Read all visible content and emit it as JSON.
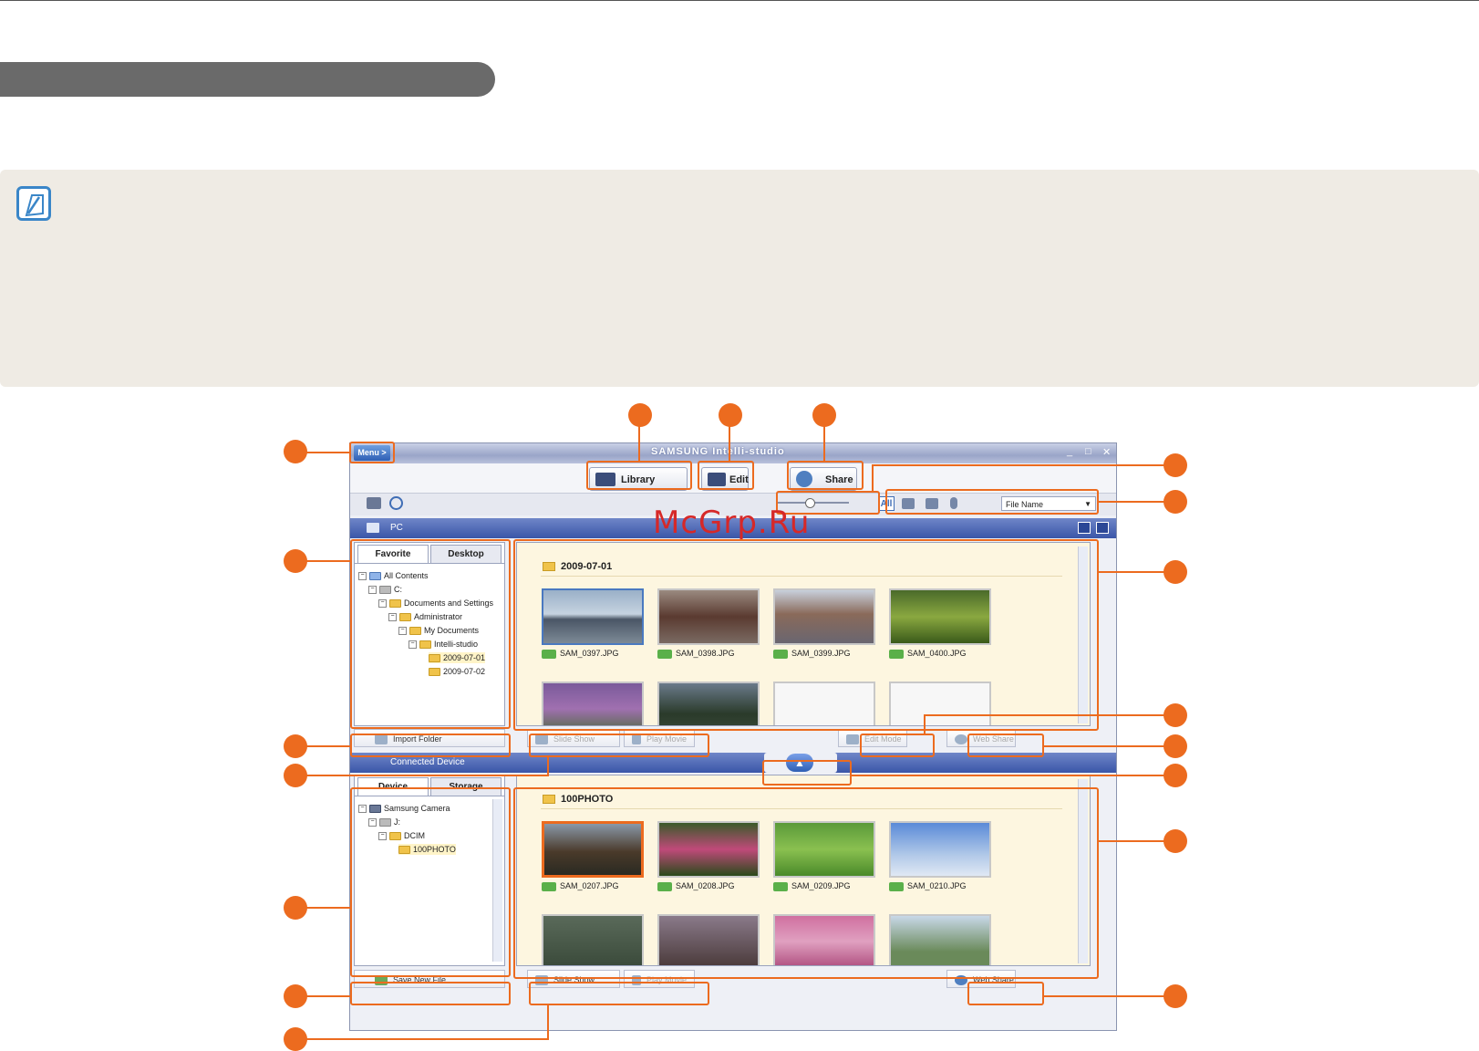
{
  "watermark": "McGrp.Ru",
  "app": {
    "title": "SAMSUNG Intelli-studio",
    "menu_label": "Menu >",
    "modes": [
      {
        "label": "Library",
        "icon": "library-icon"
      },
      {
        "label": "Edit",
        "icon": "edit-icon"
      },
      {
        "label": "Share",
        "icon": "globe-icon"
      }
    ],
    "sort_select": "File Name",
    "filter_all": "All"
  },
  "pc_pane": {
    "header": "PC",
    "tabs": [
      "Favorite",
      "Desktop"
    ],
    "tree": [
      "All Contents",
      "C:",
      "Documents and Settings",
      "Administrator",
      "My Documents",
      "Intelli-studio",
      "2009-07-01",
      "2009-07-02"
    ],
    "folder": "2009-07-01",
    "files": [
      "SAM_0397.JPG",
      "SAM_0398.JPG",
      "SAM_0399.JPG",
      "SAM_0400.JPG"
    ],
    "buttons": {
      "import": "Import Folder",
      "slideshow": "Slide Show",
      "play": "Play Movie",
      "edit_mode": "Edit Mode",
      "web_share": "Web Share"
    }
  },
  "device_pane": {
    "header": "Connected Device",
    "tabs": [
      "Device",
      "Storage"
    ],
    "tree": [
      "Samsung Camera",
      "J:",
      "DCIM",
      "100PHOTO"
    ],
    "folder": "100PHOTO",
    "files": [
      "SAM_0207.JPG",
      "SAM_0208.JPG",
      "SAM_0209.JPG",
      "SAM_0210.JPG"
    ],
    "buttons": {
      "save": "Save New File",
      "slideshow": "Slide Show",
      "play": "Play Movie",
      "web_share": "Web Share"
    }
  },
  "colors": {
    "accent": "#ec6b1f",
    "note_bg": "#efebe4",
    "pill": "#6a6a6a",
    "gallery_bg": "#fdf6e0",
    "watermark": "#d62828"
  }
}
